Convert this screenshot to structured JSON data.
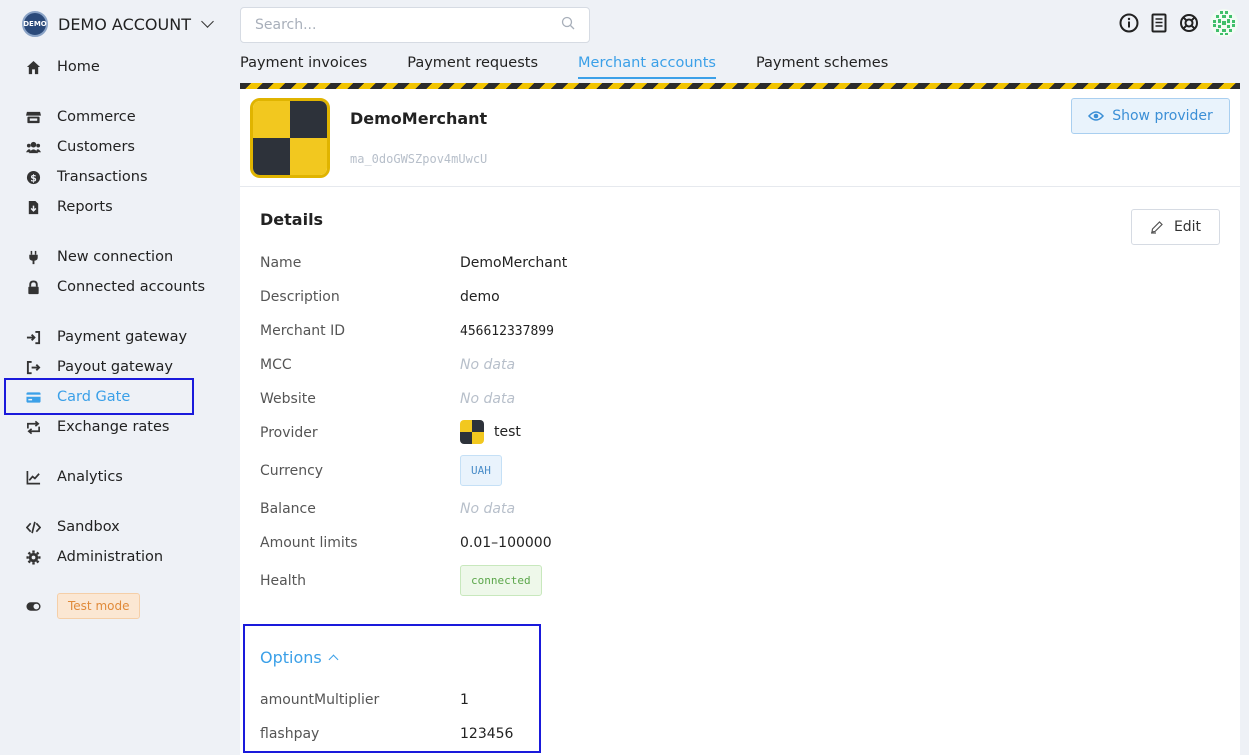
{
  "account": {
    "logo_text": "DEMO",
    "name": "DEMO ACCOUNT"
  },
  "search": {
    "placeholder": "Search..."
  },
  "sidebar": {
    "items": [
      {
        "label": "Home"
      },
      {
        "label": "Commerce"
      },
      {
        "label": "Customers"
      },
      {
        "label": "Transactions"
      },
      {
        "label": "Reports"
      },
      {
        "label": "New connection"
      },
      {
        "label": "Connected accounts"
      },
      {
        "label": "Payment gateway"
      },
      {
        "label": "Payout gateway"
      },
      {
        "label": "Card Gate"
      },
      {
        "label": "Exchange rates"
      },
      {
        "label": "Analytics"
      },
      {
        "label": "Sandbox"
      },
      {
        "label": "Administration"
      }
    ],
    "test_mode": "Test mode"
  },
  "tabs": [
    {
      "label": "Payment invoices"
    },
    {
      "label": "Payment requests"
    },
    {
      "label": "Merchant accounts"
    },
    {
      "label": "Payment schemes"
    }
  ],
  "merchant": {
    "name": "DemoMerchant",
    "id": "ma_0doGWSZpov4mUwcU",
    "show_provider_label": "Show provider"
  },
  "details": {
    "title": "Details",
    "edit_label": "Edit",
    "rows": [
      {
        "label": "Name",
        "value": "DemoMerchant"
      },
      {
        "label": "Description",
        "value": "demo"
      },
      {
        "label": "Merchant ID",
        "value": "456612337899"
      },
      {
        "label": "MCC",
        "value": "No data"
      },
      {
        "label": "Website",
        "value": "No data"
      },
      {
        "label": "Provider",
        "value": "test"
      },
      {
        "label": "Currency",
        "value": "UAH"
      },
      {
        "label": "Balance",
        "value": "No data"
      },
      {
        "label": "Amount limits",
        "value": "0.01–100000"
      },
      {
        "label": "Health",
        "value": "connected"
      }
    ]
  },
  "options": {
    "title": "Options",
    "rows": [
      {
        "label": "amountMultiplier",
        "value": "1"
      },
      {
        "label": "flashpay",
        "value": "123456"
      }
    ]
  },
  "colors": {
    "accent": "#3ba0e8",
    "highlight": "#1a1adb",
    "stripe_yellow": "#f2c400",
    "stripe_dark": "#2b2b2b"
  }
}
